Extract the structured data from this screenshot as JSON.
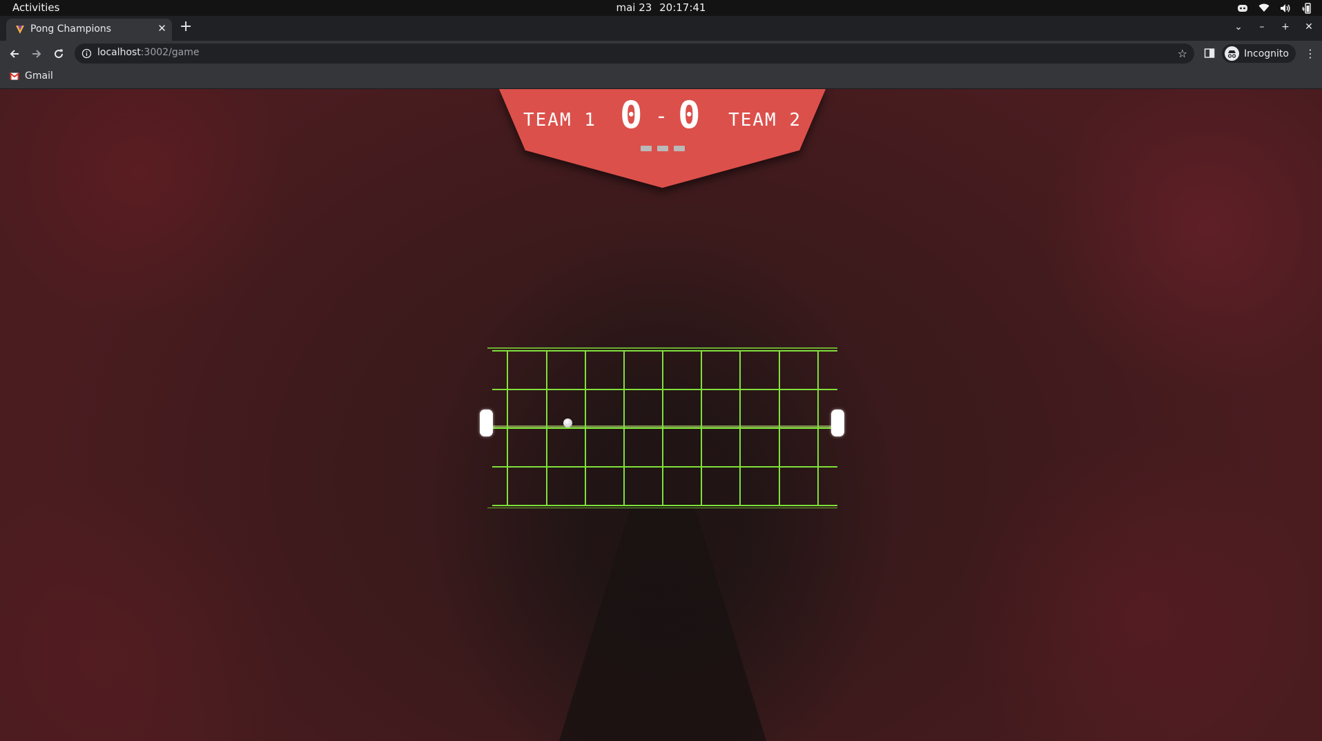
{
  "system_bar": {
    "activities": "Activities",
    "date": "mai 23",
    "time": "20:17:41"
  },
  "browser": {
    "tab": {
      "title": "Pong Champions"
    },
    "url": {
      "host": "localhost",
      "path": ":3002/game"
    },
    "profile_label": "Incognito",
    "bookmarks": [
      {
        "label": "Gmail"
      }
    ]
  },
  "game": {
    "team1": "TEAM 1",
    "team2": "TEAM 2",
    "score_left": "0",
    "score_right": "0",
    "score_separator": "-",
    "rounds": 3,
    "colors": {
      "scoreboard": "#dc504b",
      "court_lines": "#7ee23a",
      "paddles": "#ffffff"
    }
  }
}
